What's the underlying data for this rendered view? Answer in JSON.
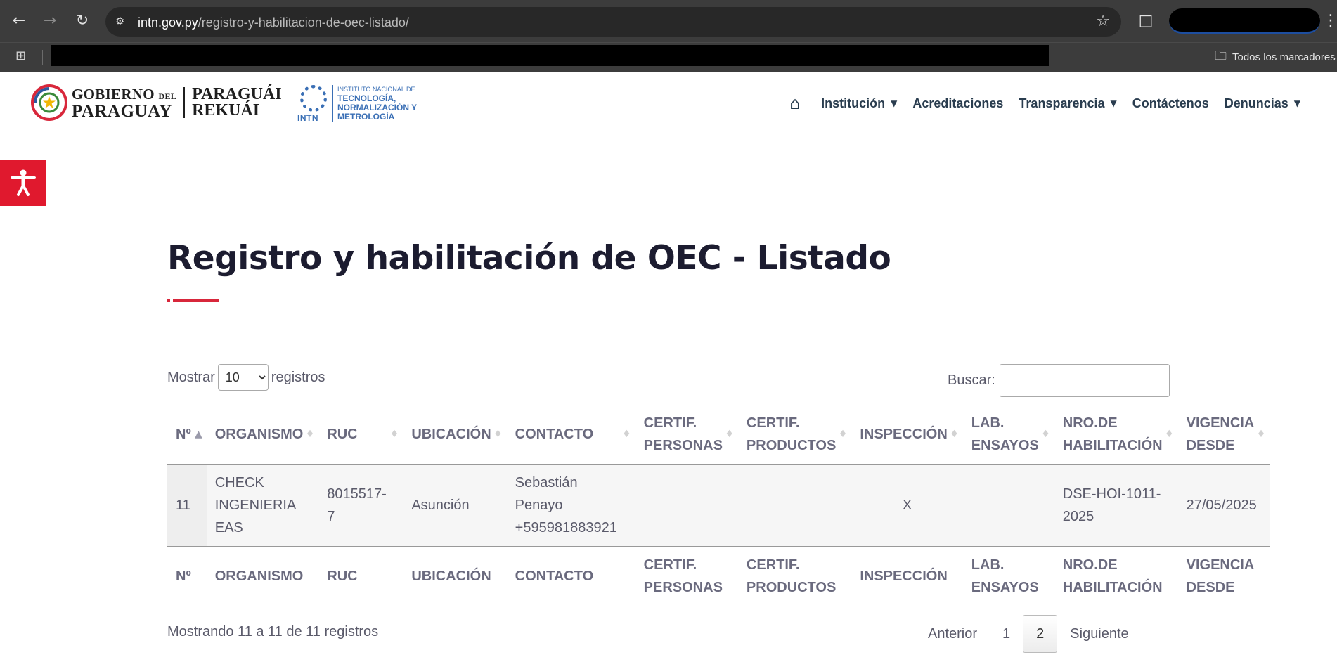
{
  "browser": {
    "url_host": "intn.gov.py",
    "url_path": "/registro-y-habilitacion-de-oec-listado/",
    "bookmarks_all_label": "Todos los marcadores"
  },
  "header": {
    "gov_line1": "GOBIERNO",
    "gov_line1_small": "DEL",
    "gov_line2": "PARAGUAY",
    "gov_text2_line1": "PARAGUÁI",
    "gov_text2_line2": "REKUÁI",
    "intn_small": "INSTITUTO NACIONAL DE",
    "intn_line1": "TECNOLOGÍA,",
    "intn_line2": "NORMALIZACIÓN Y",
    "intn_line3": "METROLOGÍA",
    "intn_mark": "INTN",
    "nav": {
      "institucion": "Institución",
      "acreditaciones": "Acreditaciones",
      "transparencia": "Transparencia",
      "contactenos": "Contáctenos",
      "denuncias": "Denuncias"
    }
  },
  "page": {
    "title": "Registro y habilitación de OEC - Listado",
    "length_label_before": "Mostrar",
    "length_value": "10",
    "length_label_after": "registros",
    "search_label": "Buscar:",
    "search_value": ""
  },
  "table": {
    "headers": [
      "Nº",
      "ORGANISMO",
      "RUC",
      "UBICACIÓN",
      "CONTACTO",
      "CERTIF. PERSONAS",
      "CERTIF. PRODUCTOS",
      "INSPECCIÓN",
      "LAB. ENSAYOS",
      "NRO.DE HABILITACIÓN",
      "VIGENCIA DESDE"
    ],
    "header_lines": [
      [
        "Nº"
      ],
      [
        "ORGANISMO"
      ],
      [
        "RUC"
      ],
      [
        "UBICACIÓN"
      ],
      [
        "CONTACTO"
      ],
      [
        "CERTIF.",
        "PERSONAS"
      ],
      [
        "CERTIF.",
        "PRODUCTOS"
      ],
      [
        "INSPECCIÓN"
      ],
      [
        "LAB.",
        "ENSAYOS"
      ],
      [
        "NRO.DE",
        "HABILITACIÓN"
      ],
      [
        "VIGENCIA",
        "DESDE"
      ]
    ],
    "rows": [
      {
        "no": "11",
        "organismo": [
          "CHECK",
          "INGENIERIA",
          "EAS"
        ],
        "ruc": [
          "8015517-",
          "7"
        ],
        "ubicacion": "Asunción",
        "contacto": [
          "Sebastián",
          "Penayo",
          "+595981883921"
        ],
        "certif_personas": "",
        "certif_productos": "",
        "inspeccion": "X",
        "lab_ensayos": "",
        "nro_habilitacion": [
          "DSE-HOI-1011-",
          "2025"
        ],
        "vigencia_desde": "27/05/2025"
      }
    ]
  },
  "footer": {
    "info": "Mostrando 11 a 11 de 11 registros",
    "prev": "Anterior",
    "page1": "1",
    "page2": "2",
    "next": "Siguiente"
  }
}
